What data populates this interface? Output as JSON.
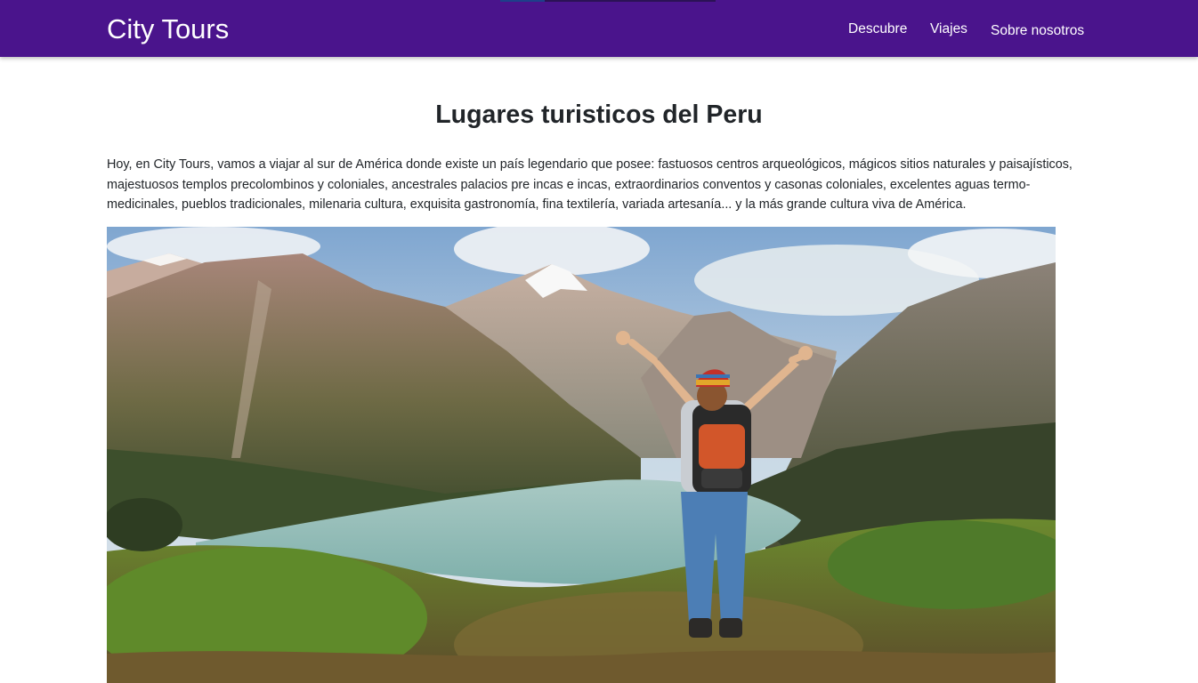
{
  "navbar": {
    "brand": "City Tours",
    "links": [
      {
        "label": "Descubre"
      },
      {
        "label": "Viajes"
      },
      {
        "label": "Sobre nosotros"
      }
    ],
    "background_color": "#4a148c"
  },
  "main": {
    "title": "Lugares turisticos del Peru",
    "intro": "Hoy, en City Tours, vamos a viajar al sur de América donde existe un país legendario que posee: fastuosos centros arqueológicos, mágicos sitios naturales y paisajísticos, majestuosos templos precolombinos y coloniales, ancestrales palacios pre incas e incas, extraordinarios conventos y casonas coloniales, excelentes aguas termo-medicinales, pueblos tradicionales, milenaria cultura, exquisita gastronomía, fina textilería, variada artesanía... y la más grande cultura viva de América."
  },
  "hero_image": {
    "subject": "hiker-with-raised-arms-over-mountain-lake-photo"
  }
}
